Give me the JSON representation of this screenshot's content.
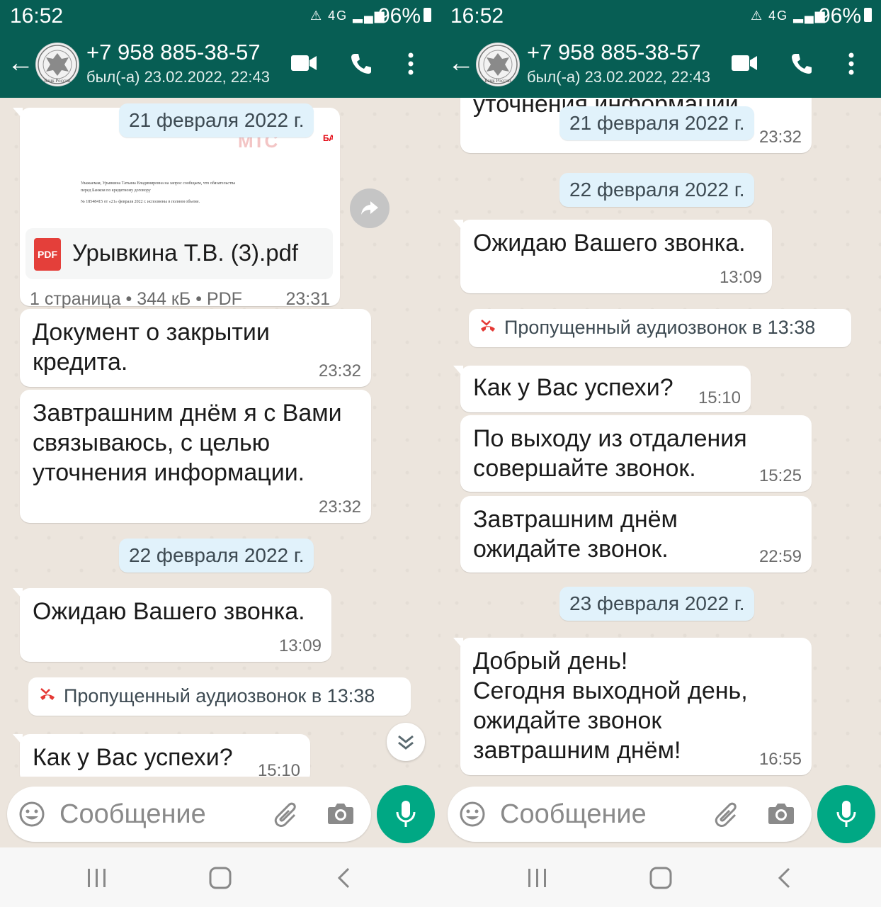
{
  "status": {
    "time": "16:52",
    "network": "4G",
    "battery": "96%"
  },
  "header": {
    "contact_name": "+7 958 885-38-57",
    "last_seen": "был(-а) 23.02.2022, 22:43",
    "avatar_text": "Банк России"
  },
  "left": {
    "date_chip_1": "21 февраля 2022 г.",
    "document": {
      "preview_logo": "МТС",
      "preview_logo_suffix": "БАНК",
      "preview_text_1": "Уважаемая, Урывкина Татьяна Владимировна на запрос сообщаем, что обязательства",
      "preview_text_2": "перед Банком по кредитному договору",
      "preview_text_3": "№ 18548415 от «21» февраля 2022 г. исполнены в полном объеме.",
      "file_icon_label": "PDF",
      "file_name": "Урывкина Т.В. (3).pdf",
      "meta": "1 страница • 344 кБ • PDF",
      "time": "23:31"
    },
    "msg_1": {
      "text": "Документ о закрытии\nкредита.",
      "time": "23:32"
    },
    "msg_2": {
      "text": "Завтрашним днём я с Вами\nсвязываюсь, с целью\nуточнения информации.",
      "time": "23:32"
    },
    "date_chip_2": "22 февраля 2022 г.",
    "msg_3": {
      "text": "Ожидаю Вашего звонка.",
      "time": "13:09"
    },
    "missed_call": "Пропущенный аудиозвонок в 13:38",
    "msg_4": {
      "text": "Как у Вас успехи?",
      "time": "15:10"
    }
  },
  "right": {
    "partial_msg": {
      "text": "уточнения информации.",
      "time": "23:32"
    },
    "date_chip_1": "21 февраля 2022 г.",
    "date_chip_2": "22 февраля 2022 г.",
    "msg_1": {
      "text": "Ожидаю Вашего звонка.",
      "time": "13:09"
    },
    "missed_call": "Пропущенный аудиозвонок в 13:38",
    "msg_2": {
      "text": "Как у Вас успехи?",
      "time": "15:10"
    },
    "msg_3": {
      "text": "По выходу из отдаления\nсовершайте звонок.",
      "time": "15:25"
    },
    "msg_4": {
      "text": "Завтрашним днём\nожидайте звонок.",
      "time": "22:59"
    },
    "date_chip_3": "23 февраля 2022 г.",
    "msg_5": {
      "text": "Добрый день!\nСегодня выходной день,\nожидайте звонок\nзавтрашним днём!",
      "time": "16:55"
    }
  },
  "input": {
    "placeholder": "Сообщение"
  },
  "colors": {
    "header": "#075e54",
    "mic_button": "#00a884",
    "chat_bg": "#ece5dd",
    "date_chip": "#e1f2fb",
    "missed_call_icon": "#e53935"
  },
  "icons": [
    "back-arrow-icon",
    "video-call-icon",
    "phone-icon",
    "more-options-icon",
    "forward-icon",
    "scroll-down-icon",
    "emoji-icon",
    "attach-icon",
    "camera-icon",
    "mic-icon",
    "missed-call-icon",
    "recents-icon",
    "home-icon",
    "back-nav-icon"
  ]
}
